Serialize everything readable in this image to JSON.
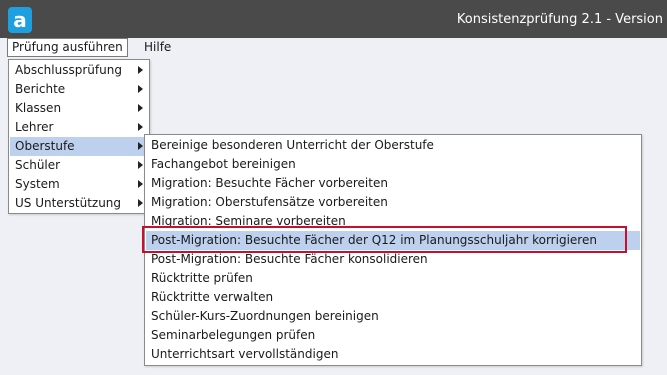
{
  "window": {
    "title": "Konsistenzprüfung 2.1 - Version",
    "app_icon_letter": "a"
  },
  "menubar": {
    "items": [
      {
        "label": "Prüfung ausführen"
      },
      {
        "label": "Hilfe"
      }
    ]
  },
  "dropdown": {
    "items": [
      {
        "label": "Abschlussprüfung"
      },
      {
        "label": "Berichte"
      },
      {
        "label": "Klassen"
      },
      {
        "label": "Lehrer"
      },
      {
        "label": "Oberstufe",
        "active": true
      },
      {
        "label": "Schüler"
      },
      {
        "label": "System"
      },
      {
        "label": "US Unterstützung"
      }
    ]
  },
  "submenu": {
    "items": [
      {
        "label": "Bereinige besonderen Unterricht der Oberstufe"
      },
      {
        "label": "Fachangebot bereinigen"
      },
      {
        "label": "Migration: Besuchte Fächer vorbereiten"
      },
      {
        "label": "Migration: Oberstufensätze vorbereiten"
      },
      {
        "label": "Migration: Seminare vorbereiten"
      },
      {
        "label": "Post-Migration: Besuchte Fächer der Q12 im Planungsschuljahr korrigieren",
        "active": true
      },
      {
        "label": "Post-Migration: Besuchte Fächer konsolidieren"
      },
      {
        "label": "Rücktritte prüfen"
      },
      {
        "label": "Rücktritte verwalten"
      },
      {
        "label": "Schüler-Kurs-Zuordnungen bereinigen"
      },
      {
        "label": "Seminarbelegungen prüfen"
      },
      {
        "label": "Unterrichtsart vervollständigen"
      }
    ]
  },
  "colors": {
    "titlebar": "#4a4a4a",
    "app_icon": "#1ea0e0",
    "background": "#eef0f6",
    "selection": "#bdd1ef",
    "highlight_border": "#c8102e"
  }
}
